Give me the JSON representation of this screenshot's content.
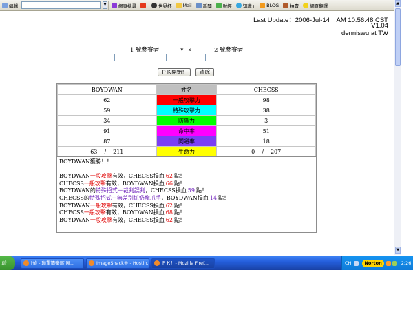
{
  "toolbar": {
    "items": [
      {
        "label": "編輯",
        "icon": "edit-icon"
      },
      {
        "label": "網頁搜尋",
        "icon": "search-icon"
      },
      {
        "label": "世界杯",
        "icon": "soccer-icon"
      },
      {
        "label": "Mail",
        "icon": "mail-icon"
      },
      {
        "label": "新聞",
        "icon": "news-icon"
      },
      {
        "label": "財經",
        "icon": "finance-icon"
      },
      {
        "label": "知識+",
        "icon": "knowledge-icon"
      },
      {
        "label": "BLOG",
        "icon": "blog-icon"
      },
      {
        "label": "拍賣",
        "icon": "auction-icon"
      },
      {
        "label": "網頁翻譯",
        "icon": "translate-icon"
      }
    ]
  },
  "header": {
    "last_update": "Last Update：2006-Jul-14　AM 10:56:48 CST",
    "version": "V1.04",
    "author": "denniswu at TW"
  },
  "form": {
    "label1": "1 號參賽者",
    "vs": "v s",
    "label2": "2 號參賽者",
    "input1": "",
    "input2": "",
    "pk_button": "ＰＫ開始！",
    "clear_button": "清除"
  },
  "stats": {
    "player1": "BOYDWAN",
    "header_mid": "姓名",
    "player2": "CHECSS",
    "rows": [
      {
        "label": "一般攻擊力",
        "p1": "62",
        "p2": "98",
        "color": "#ff0000"
      },
      {
        "label": "特殊攻擊力",
        "p1": "59",
        "p2": "38",
        "color": "#00ffff"
      },
      {
        "label": "防禦力",
        "p1": "34",
        "p2": "3",
        "color": "#00ff00"
      },
      {
        "label": "命中率",
        "p1": "91",
        "p2": "51",
        "color": "#ff00ff"
      },
      {
        "label": "閃避率",
        "p1": "87",
        "p2": "18",
        "color": "#7b3ff5"
      },
      {
        "label": "生命力",
        "p1_cur": "63",
        "p1_max": "211",
        "p2_cur": "0",
        "p2_max": "207",
        "slash": "/",
        "color": "#ffff00"
      }
    ],
    "header_mid_color": "#c0c0c0"
  },
  "log": {
    "winner": "BOYDWAN獲勝！！",
    "lines": [
      {
        "a": "BOYDWAN",
        "move": "一般攻擊",
        "mid": "有效，CHECSS損血",
        "dmg": "62",
        "end": "點！",
        "c": "red"
      },
      {
        "a": "CHECSS",
        "move": "一般攻擊",
        "mid": "有效，BOYDWAN損血",
        "dmg": "66",
        "end": "點！",
        "c": "red"
      },
      {
        "a": "BOYDWAN的",
        "move": "特殊招式－裁判誤判",
        "mid": "，CHECSS損血",
        "dmg": "59",
        "end": "點！",
        "c": "pur"
      },
      {
        "a": "CHECSS的",
        "move": "特殊招式－無差別抓奶龍爪手",
        "mid": "，BOYDWAN損血",
        "dmg": "14",
        "end": "點！",
        "c": "pur"
      },
      {
        "a": "BOYDWAN",
        "move": "一般攻擊",
        "mid": "有效，CHECSS損血",
        "dmg": "62",
        "end": "點！",
        "c": "red"
      },
      {
        "a": "CHECSS",
        "move": "一般攻擊",
        "mid": "有效，BOYDWAN損血",
        "dmg": "68",
        "end": "點！",
        "c": "red"
      },
      {
        "a": "BOYDWAN",
        "move": "一般攻擊",
        "mid": "有效，CHECSS損血",
        "dmg": "62",
        "end": "點！",
        "c": "red"
      }
    ]
  },
  "taskbar": {
    "start": "始",
    "tasks": [
      {
        "label": "[偵 - 聯重讀樂部]展...",
        "icon": "firefox-icon"
      },
      {
        "label": "ImageShack® - Hostin...",
        "icon": "firefox-icon"
      },
      {
        "label": "ＰＫ！- Mozilla Firef...",
        "icon": "firefox-icon",
        "active": true
      }
    ],
    "lang": "CH",
    "norton": "Norton",
    "clock": "2:26"
  }
}
